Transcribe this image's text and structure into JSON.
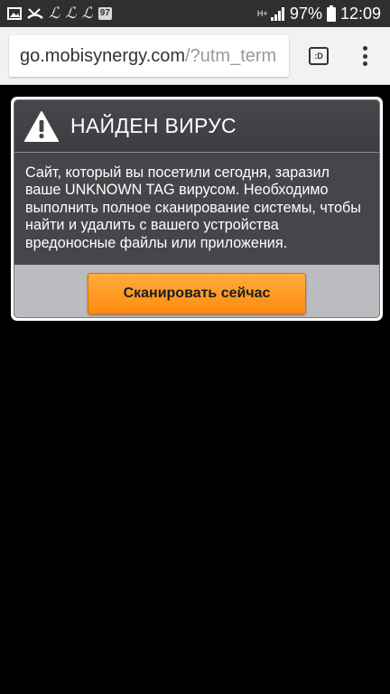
{
  "status_bar": {
    "battery_percent": "97%",
    "time": "12:09",
    "notification_badge": "97",
    "network_type": "H+",
    "left_icons": [
      "image-icon",
      "missed-call-icon",
      "l-app-icon",
      "l-app-icon",
      "l-app-icon",
      "badge-97-icon"
    ],
    "right_icons": [
      "network-hplus-icon",
      "signal-icon",
      "battery-icon"
    ]
  },
  "browser": {
    "url_domain": "go.mobisynergy.com",
    "url_path": "/?utm_term",
    "tabs_label": ":D",
    "icons": [
      "tabs-icon",
      "overflow-menu-icon"
    ]
  },
  "dialog": {
    "title": "НАЙДЕН ВИРУС",
    "body_text": "Сайт, который вы посетили сегодня, заразил ваше UNKNOWN TAG вирусом. Необходимо выполнить полное сканирование системы, чтобы найти и удалить с вашего устройства вредоносные файлы или приложения.",
    "button_label": "Сканировать сейчас",
    "header_icon": "warning-icon"
  },
  "colors": {
    "status_bar_bg": "#2f2f2f",
    "browser_bar_bg": "#f2f2f2",
    "page_bg": "#000000",
    "dialog_bg": "#46464a",
    "dialog_footer_bg": "#bcbbc0",
    "button_orange": "#ff9a22"
  }
}
